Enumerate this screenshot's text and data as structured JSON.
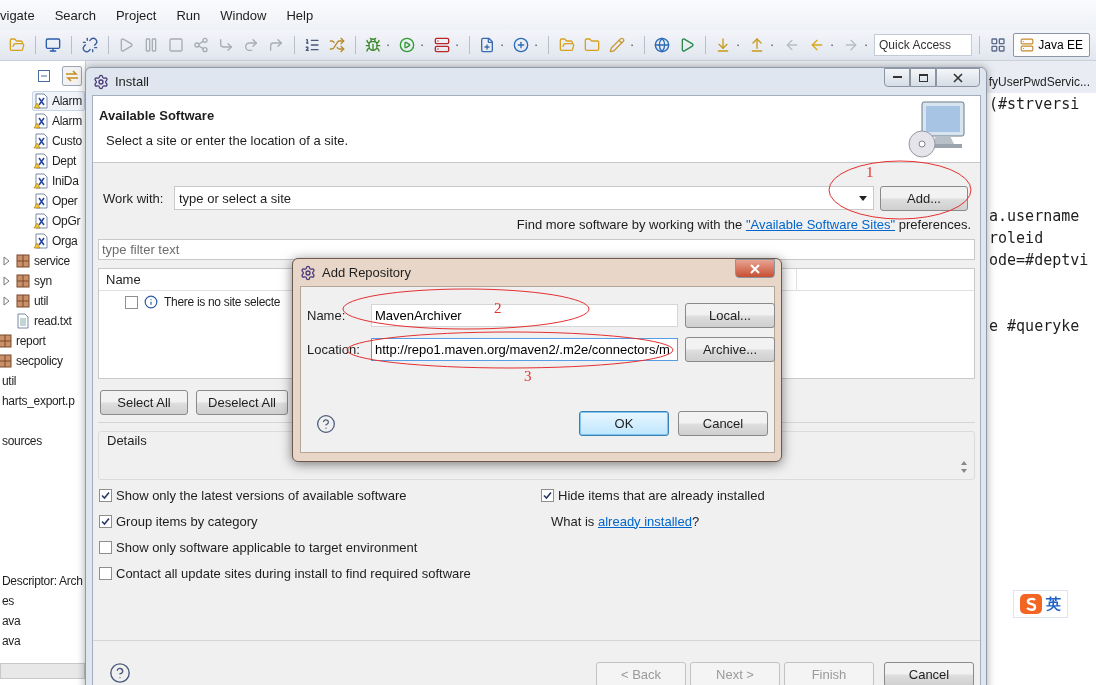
{
  "menu_bar": [
    "vigate",
    "Search",
    "Project",
    "Run",
    "Window",
    "Help"
  ],
  "toolbar": {
    "quick_access": {
      "placeholder": "Quick Access"
    },
    "perspective": {
      "label": "Java EE",
      "selected": true
    }
  },
  "project_tree": [
    [
      {
        "children": [
          {
            "children": [
              {
                "children": [
                  {
                    "label": "Alarm",
                    "kind": "class",
                    "selected": true
                  },
                  {
                    "label": "Alarm",
                    "kind": "class",
                    "selected": false
                  },
                  {
                    "label": "Custo",
                    "kind": "class",
                    "selected": false
                  },
                  {
                    "label": "Dept",
                    "kind": "class",
                    "selected": false
                  },
                  {
                    "label": "IniDa",
                    "kind": "class",
                    "selected": false
                  },
                  {
                    "label": "Oper",
                    "kind": "class",
                    "selected": false
                  },
                  {
                    "label": "OpGr",
                    "kind": "class",
                    "selected": false
                  },
                  {
                    "label": "Orga",
                    "kind": "class",
                    "selected": false
                  }
                ]
              },
              {
                "label": "service",
                "kind": "package",
                "expanded": false
              },
              {
                "label": "syn",
                "kind": "package",
                "expanded": false
              },
              {
                "label": "util",
                "kind": "package",
                "expanded": false
              },
              {
                "label": "read.txt",
                "kind": "file"
              }
            ]
          },
          {
            "label": "report",
            "kind": "package"
          },
          {
            "label": "secpolicy",
            "kind": "package"
          }
        ]
      },
      {
        "label": "util"
      },
      {
        "label": "harts_export.p"
      }
    ],
    [
      {
        "label": "sources"
      }
    ],
    [
      {
        "label": "Descriptor: Arch"
      },
      {
        "label": "es"
      },
      {
        "label": "ava"
      },
      {
        "label": "ava"
      }
    ]
  ],
  "editor": {
    "tab": "fyUserPwdServic...",
    "code_blocks": [
      [
        "(#strversi"
      ],
      [
        "a.username",
        "roleid",
        "ode=#deptvi"
      ],
      [
        "e #queryke"
      ]
    ]
  },
  "install_dialog": {
    "title": "Install",
    "header_title": "Available Software",
    "header_subtitle": "Select a site or enter the location of a site.",
    "work_with": {
      "label": "Work with:",
      "value": "type or select a site"
    },
    "add_button": "Add...",
    "find_more": {
      "text": "Find more software by working with the",
      "link": "\"Available Software Sites\"",
      "suffix": "preferences."
    },
    "filter": {
      "placeholder": "type filter text"
    },
    "table": {
      "columns": [
        "Name"
      ],
      "rows": [
        {
          "checked": false,
          "text": "There is no site selecte"
        }
      ]
    },
    "select_buttons": [
      "Select All",
      "Deselect All"
    ],
    "details": {
      "label": "Details"
    },
    "options": [
      {
        "label": "Show only the latest versions of available software",
        "checked": true
      },
      {
        "label": "Group items by category",
        "checked": true
      },
      {
        "label": "Show only software applicable to target environment",
        "checked": false
      },
      {
        "label": "Contact all update sites during install to find required software",
        "checked": false
      }
    ],
    "hide_installed": {
      "label": "Hide items that are already installed",
      "checked": true
    },
    "what_is": {
      "text": "What is",
      "link": "already installed",
      "suffix": "?"
    },
    "nav_buttons": [
      {
        "label": "< Back",
        "disabled": true
      },
      {
        "label": "Next >",
        "disabled": true
      },
      {
        "label": "Finish",
        "disabled": true
      },
      {
        "label": "Cancel",
        "disabled": false
      }
    ]
  },
  "add_repository": {
    "title": "Add Repository",
    "fields": [
      {
        "label": "Name:",
        "value": "MavenArchiver",
        "button": "Local..."
      },
      {
        "label": "Location:",
        "value": "http://repo1.maven.org/maven2/.m2e/connectors/m",
        "button": "Archive..."
      }
    ],
    "buttons": [
      {
        "label": "OK",
        "default": true
      },
      {
        "label": "Cancel",
        "default": false
      }
    ]
  },
  "annotations": [
    "1",
    "2",
    "3"
  ],
  "ime_bar": {
    "label": "英"
  }
}
